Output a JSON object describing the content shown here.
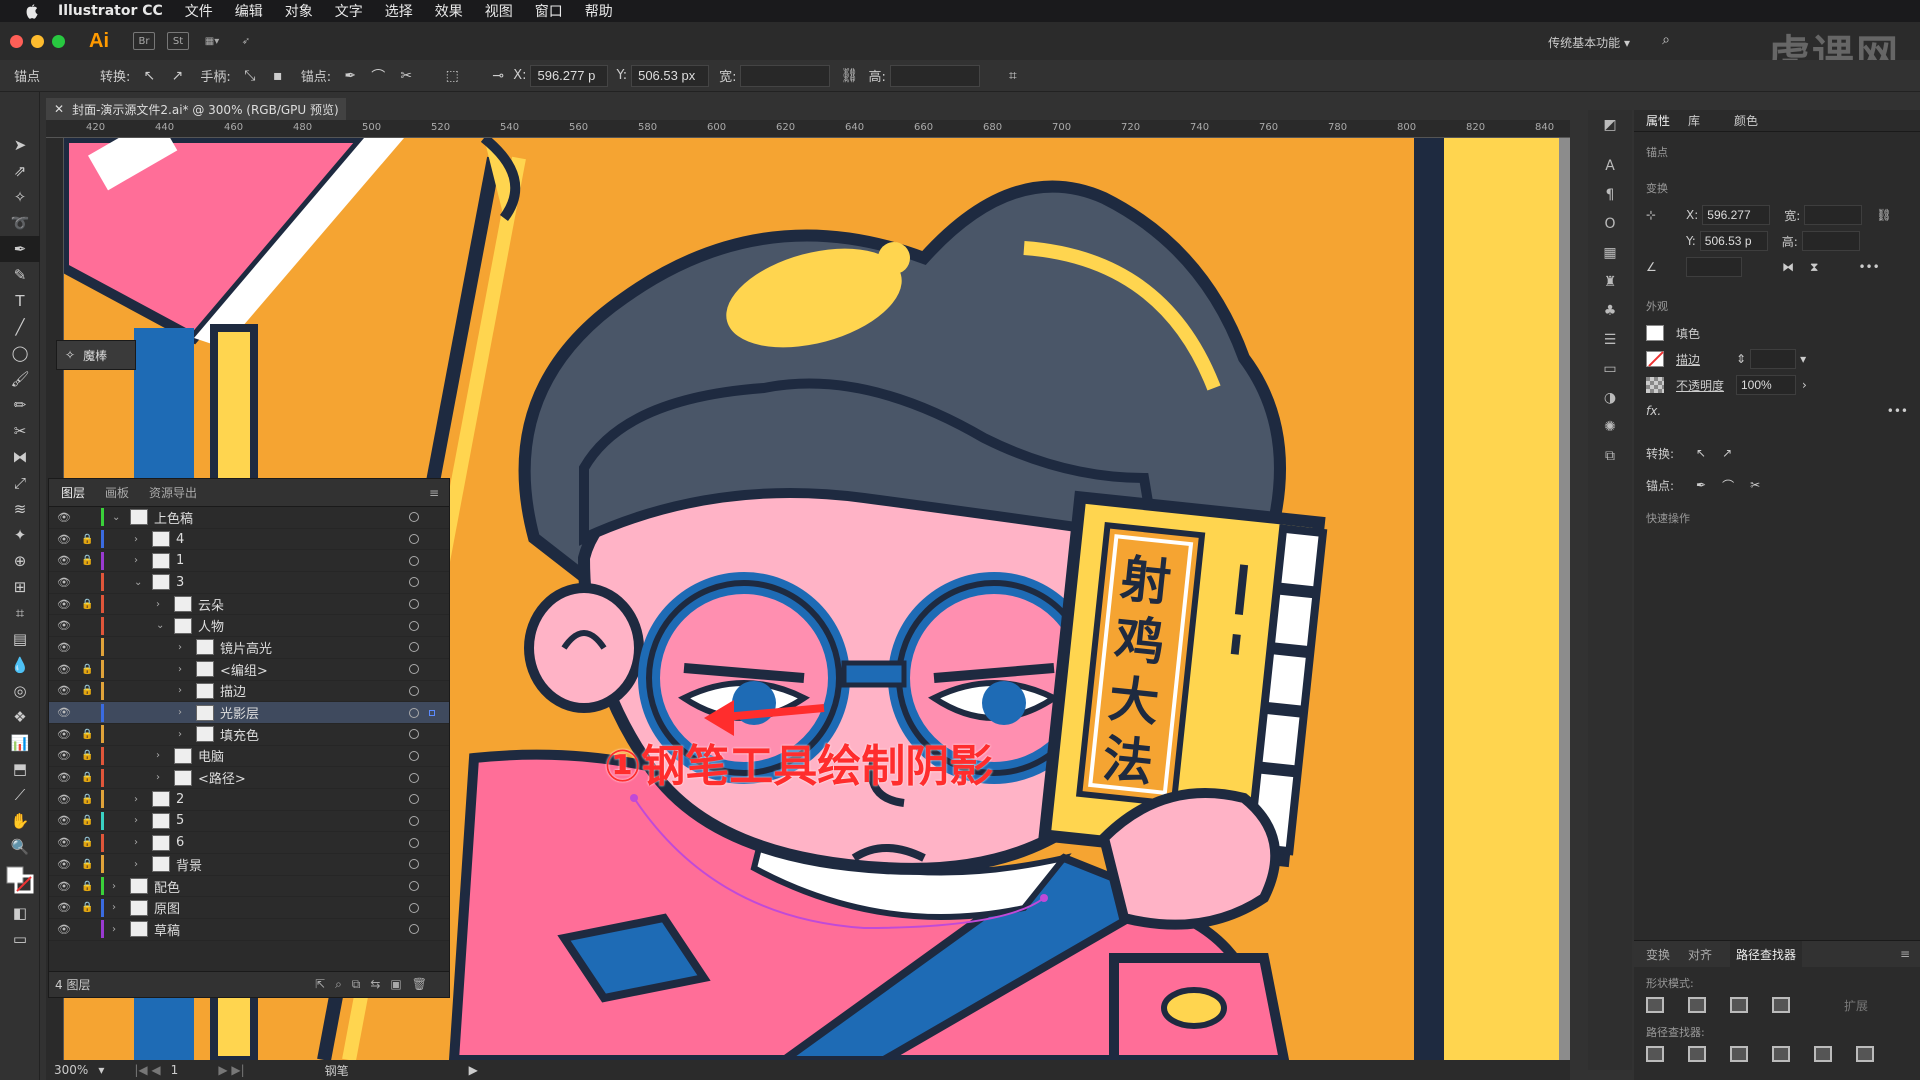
{
  "menubar": {
    "app_name": "Illustrator CC",
    "items": [
      "文件",
      "编辑",
      "对象",
      "文字",
      "选择",
      "效果",
      "视图",
      "窗口",
      "帮助"
    ]
  },
  "appbar": {
    "logo": "Ai",
    "br_label": "Br",
    "st_label": "St",
    "workspace": "传统基本功能",
    "watermark": "虎课网"
  },
  "control_bar": {
    "anchor_label": "锚点",
    "convert_label": "转换:",
    "handle_label": "手柄:",
    "anchor_pts_label": "锚点:",
    "x_label": "X:",
    "x_value": "596.277 p",
    "y_label": "Y:",
    "y_value": "506.53 px",
    "width_label": "宽:",
    "height_label": "高:"
  },
  "document": {
    "tab_title": "封面-演示源文件2.ai* @ 300% (RGB/GPU 预览)",
    "ruler_ticks": [
      "420",
      "440",
      "460",
      "480",
      "500",
      "520",
      "540",
      "560",
      "580",
      "600",
      "620",
      "640",
      "660",
      "680",
      "700",
      "720",
      "740",
      "760",
      "780",
      "800",
      "820",
      "840"
    ]
  },
  "minipanel": {
    "label": "魔棒"
  },
  "layers_panel": {
    "tabs": [
      "图层",
      "画板",
      "资源导出"
    ],
    "rows": [
      {
        "name": "上色稿",
        "indent": 0,
        "expanded": true,
        "color": "#3ad13a",
        "lock": false
      },
      {
        "name": "4",
        "indent": 1,
        "expanded": false,
        "color": "#3a6be0",
        "lock": true
      },
      {
        "name": "1",
        "indent": 1,
        "expanded": false,
        "color": "#9a3ad1",
        "lock": true
      },
      {
        "name": "3",
        "indent": 1,
        "expanded": true,
        "color": "#e0563a",
        "lock": false
      },
      {
        "name": "云朵",
        "indent": 2,
        "expanded": false,
        "color": "#e0563a",
        "lock": true
      },
      {
        "name": "人物",
        "indent": 2,
        "expanded": true,
        "color": "#e0563a",
        "lock": false
      },
      {
        "name": "镜片高光",
        "indent": 3,
        "expanded": false,
        "color": "#e0a33a",
        "lock": false
      },
      {
        "name": "<编组>",
        "indent": 3,
        "expanded": false,
        "color": "#e0a33a",
        "lock": true
      },
      {
        "name": "描边",
        "indent": 3,
        "expanded": false,
        "color": "#e0a33a",
        "lock": true
      },
      {
        "name": "光影层",
        "indent": 3,
        "expanded": false,
        "color": "#3a6be0",
        "lock": false,
        "selected": true
      },
      {
        "name": "填充色",
        "indent": 3,
        "expanded": false,
        "color": "#e0a33a",
        "lock": true
      },
      {
        "name": "电脑",
        "indent": 2,
        "expanded": false,
        "color": "#e0563a",
        "lock": true
      },
      {
        "name": "<路径>",
        "indent": 2,
        "expanded": false,
        "color": "#e0563a",
        "lock": true
      },
      {
        "name": "2",
        "indent": 1,
        "expanded": false,
        "color": "#e0a33a",
        "lock": true
      },
      {
        "name": "5",
        "indent": 1,
        "expanded": false,
        "color": "#3ad1c3",
        "lock": true
      },
      {
        "name": "6",
        "indent": 1,
        "expanded": false,
        "color": "#e0563a",
        "lock": true
      },
      {
        "name": "背景",
        "indent": 1,
        "expanded": false,
        "color": "#e0a33a",
        "lock": true
      },
      {
        "name": "配色",
        "indent": 0,
        "expanded": false,
        "color": "#3ad13a",
        "lock": true
      },
      {
        "name": "原图",
        "indent": 0,
        "expanded": false,
        "color": "#3a6be0",
        "lock": true
      },
      {
        "name": "草稿",
        "indent": 0,
        "expanded": false,
        "color": "#9a3ad1",
        "lock": false
      }
    ],
    "footer": "4 图层"
  },
  "properties": {
    "tabs": [
      "属性",
      "库",
      "颜色"
    ],
    "anchor_section": "锚点",
    "transform_section": "变换",
    "x_value": "596.277",
    "y_value": "506.53 p",
    "w_label": "宽:",
    "h_label": "高:",
    "appearance_section": "外观",
    "fill_label": "填色",
    "stroke_label": "描边",
    "opacity_label": "不透明度",
    "opacity_value": "100%",
    "fx_label": "fx.",
    "convert_label": "转换:",
    "anchor_label": "锚点:",
    "quick_actions": "快速操作"
  },
  "pathfinder": {
    "tabs": [
      "变换",
      "对齐",
      "路径查找器"
    ],
    "shape_modes": "形状模式:",
    "expand": "扩展",
    "pathfinders": "路径查找器:"
  },
  "status_bar": {
    "zoom": "300%",
    "artboard": "1",
    "tool": "钢笔"
  },
  "artwork": {
    "book_title": "射鸡大法",
    "annotation": "①钢笔工具绘制阴影"
  }
}
